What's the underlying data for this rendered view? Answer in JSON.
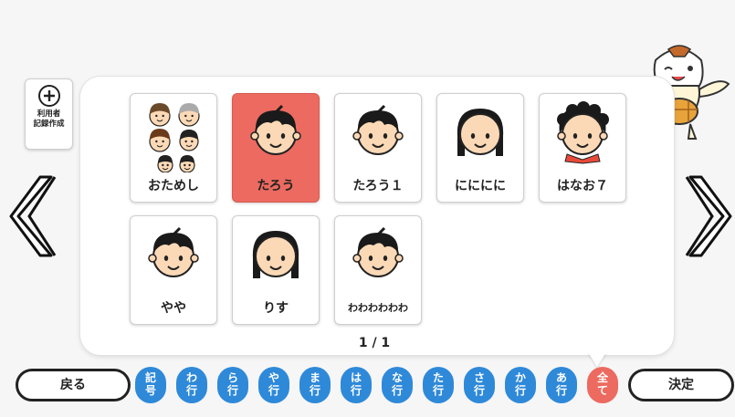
{
  "register_button": {
    "lines": [
      "利用者",
      "記録作成"
    ]
  },
  "users": [
    {
      "name": "おためし",
      "face": "group",
      "selected": false
    },
    {
      "name": "たろう",
      "face": "boy",
      "selected": true
    },
    {
      "name": "たろう１",
      "face": "boy",
      "selected": false
    },
    {
      "name": "にににに",
      "face": "girl",
      "selected": false
    },
    {
      "name": "はなお７",
      "face": "curly",
      "selected": false
    },
    {
      "name": "やや",
      "face": "boy",
      "selected": false
    },
    {
      "name": "りす",
      "face": "girl",
      "selected": false
    },
    {
      "name": "わわわわわわ",
      "face": "boy",
      "selected": false
    }
  ],
  "pagination": "1 / 1",
  "back_label": "戻る",
  "confirm_label": "決定",
  "kana_filters": [
    {
      "lines": [
        "記",
        "号"
      ],
      "active": false
    },
    {
      "lines": [
        "わ",
        "行"
      ],
      "active": false
    },
    {
      "lines": [
        "ら",
        "行"
      ],
      "active": false
    },
    {
      "lines": [
        "や",
        "行"
      ],
      "active": false
    },
    {
      "lines": [
        "ま",
        "行"
      ],
      "active": false
    },
    {
      "lines": [
        "は",
        "行"
      ],
      "active": false
    },
    {
      "lines": [
        "な",
        "行"
      ],
      "active": false
    },
    {
      "lines": [
        "た",
        "行"
      ],
      "active": false
    },
    {
      "lines": [
        "さ",
        "行"
      ],
      "active": false
    },
    {
      "lines": [
        "か",
        "行"
      ],
      "active": false
    },
    {
      "lines": [
        "あ",
        "行"
      ],
      "active": false
    },
    {
      "lines": [
        "全",
        "て"
      ],
      "active": true
    }
  ],
  "colors": {
    "kana": "#2f89d9",
    "selected": "#ec6a60",
    "skin": "#fcd9b6",
    "hair": "#1a1a1a"
  }
}
